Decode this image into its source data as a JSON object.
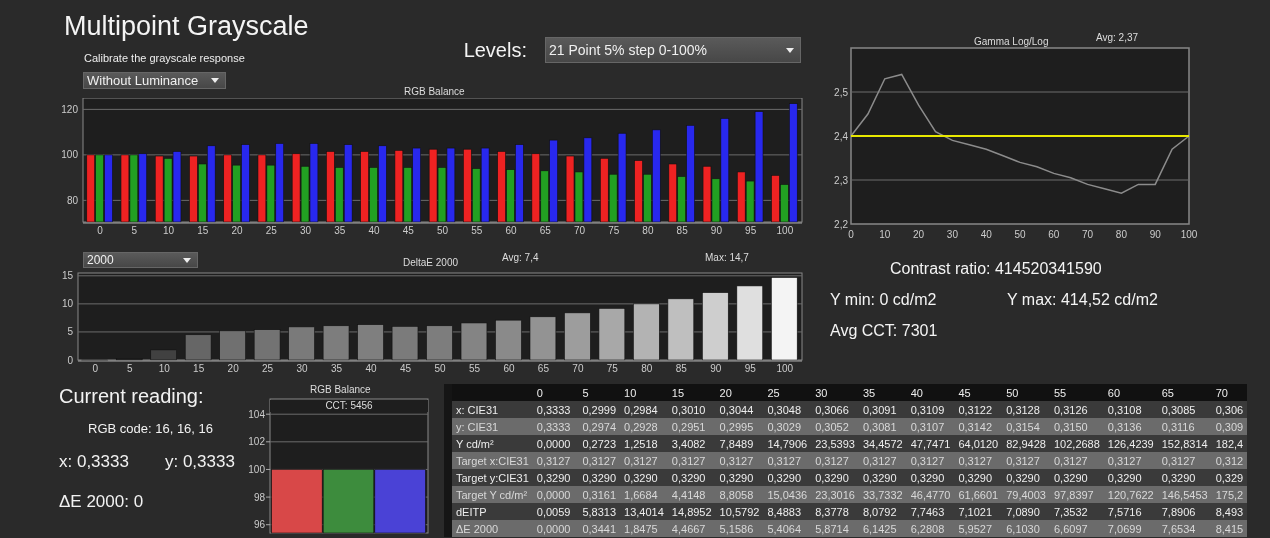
{
  "title": "Multipoint Grayscale",
  "calibrate_label": "Calibrate the grayscale response",
  "mode_dropdown": {
    "value": "Without Luminance"
  },
  "levels": {
    "label": "Levels:",
    "value": "21 Point 5% step 0-100%"
  },
  "rgb_balance": {
    "chart_data": {
      "type": "bar",
      "title": "RGB Balance",
      "categories": [
        "0",
        "5",
        "10",
        "15",
        "20",
        "25",
        "30",
        "35",
        "40",
        "45",
        "50",
        "55",
        "60",
        "65",
        "70",
        "75",
        "80",
        "85",
        "90",
        "95",
        "100"
      ],
      "ylim": [
        70.5,
        125
      ],
      "yticks": [
        80,
        100,
        120
      ],
      "grid": true,
      "series": [
        {
          "color": "#ee2222",
          "values": [
            100,
            100,
            99.5,
            99.5,
            100,
            100,
            100.5,
            101.5,
            101.5,
            102,
            102.5,
            102.5,
            101.5,
            100.5,
            99.5,
            98.5,
            97.5,
            96,
            95,
            92.5,
            91
          ]
        },
        {
          "color": "#22a022",
          "values": [
            100,
            100,
            98.5,
            96,
            95.5,
            95.5,
            95,
            94.5,
            94.5,
            94.5,
            94.5,
            94,
            93.5,
            93,
            92.5,
            91.5,
            91.5,
            90.5,
            89.5,
            88.5,
            87
          ]
        },
        {
          "color": "#2828ee",
          "values": [
            100,
            100.5,
            101.5,
            104,
            104.5,
            105,
            105,
            104.5,
            104,
            103,
            103,
            103,
            104.5,
            106.5,
            107.5,
            109.5,
            111,
            113,
            116,
            119,
            122.5
          ]
        }
      ]
    }
  },
  "delta_e": {
    "dropdown": {
      "value": "2000"
    },
    "avg": "Avg: 7,4",
    "max": "Max: 14,7",
    "chart_data": {
      "type": "bar",
      "title": "DeltaE 2000",
      "categories": [
        "0",
        "5",
        "10",
        "15",
        "20",
        "25",
        "30",
        "35",
        "40",
        "45",
        "50",
        "55",
        "60",
        "65",
        "70",
        "75",
        "80",
        "85",
        "90",
        "95",
        "100"
      ],
      "ylim": [
        0,
        15.5
      ],
      "yticks": [
        0,
        5,
        10,
        15
      ],
      "grid": true,
      "series": [
        {
          "values": [
            0,
            0.3,
            1.8,
            4.5,
            5.2,
            5.4,
            5.9,
            6.1,
            6.3,
            6,
            6.1,
            6.6,
            7.1,
            7.7,
            8.4,
            9.2,
            10,
            10.9,
            12,
            13.2,
            14.7
          ]
        }
      ]
    }
  },
  "gamma": {
    "avg": "Avg: 2,37",
    "chart_data": {
      "type": "line",
      "title": "Gamma Log/Log",
      "x": [
        0,
        5,
        10,
        15,
        20,
        25,
        30,
        35,
        40,
        45,
        50,
        55,
        60,
        65,
        70,
        75,
        80,
        85,
        90,
        95,
        100
      ],
      "xlim": [
        0,
        100
      ],
      "ylim": [
        2.2,
        2.6
      ],
      "xticks": [
        0,
        10,
        20,
        30,
        40,
        50,
        60,
        70,
        80,
        90,
        100
      ],
      "yticks": [
        {
          "value": 2.2,
          "label": "2,2"
        },
        {
          "value": 2.3,
          "label": "2,3"
        },
        {
          "value": 2.4,
          "label": "2,4"
        },
        {
          "value": 2.5,
          "label": "2,5"
        }
      ],
      "grid": true,
      "series": [
        {
          "color": "#8c8c8c",
          "values": [
            2.4,
            2.45,
            2.53,
            2.54,
            2.47,
            2.41,
            2.39,
            2.38,
            2.37,
            2.355,
            2.34,
            2.33,
            2.315,
            2.305,
            2.29,
            2.28,
            2.27,
            2.29,
            2.29,
            2.37,
            2.4
          ]
        },
        {
          "color": "#e8e800",
          "values": [
            2.4,
            2.4,
            2.4,
            2.4,
            2.4,
            2.4,
            2.4,
            2.4,
            2.4,
            2.4,
            2.4,
            2.4,
            2.4,
            2.4,
            2.4,
            2.4,
            2.4,
            2.4,
            2.4,
            2.4,
            2.4
          ]
        }
      ]
    }
  },
  "contrast_ratio": "Contrast ratio: 414520341590",
  "y_min": "Y min: 0 cd/m2",
  "y_max": "Y max: 414,52 cd/m2",
  "avg_cct": "Avg CCT: 7301",
  "current_reading": {
    "heading": "Current reading:",
    "rgb_code": "RGB code: 16, 16, 16",
    "x": "x: 0,3333",
    "y": "y: 0,3333",
    "delta_e": "ΔE 2000: 0"
  },
  "mini_balance": {
    "cct": "CCT: 5456",
    "chart_data": {
      "type": "bar",
      "title": "RGB Balance",
      "ylim": [
        95.4,
        105.1
      ],
      "yticks": [
        96,
        98,
        100,
        102,
        104
      ],
      "grid": true,
      "series": [
        {
          "color": "#d84848",
          "values": [
            100
          ]
        },
        {
          "color": "#3d8c3d",
          "values": [
            100
          ]
        },
        {
          "color": "#4a42d6",
          "values": [
            100
          ]
        }
      ]
    }
  },
  "table": {
    "columns": [
      "0",
      "5",
      "10",
      "15",
      "20",
      "25",
      "30",
      "35",
      "40",
      "45",
      "50",
      "55",
      "60",
      "65",
      "70"
    ],
    "rows": [
      {
        "label": "x: CIE31",
        "values": [
          "0,3333",
          "0,2999",
          "0,2984",
          "0,3010",
          "0,3044",
          "0,3048",
          "0,3066",
          "0,3091",
          "0,3109",
          "0,3122",
          "0,3128",
          "0,3126",
          "0,3108",
          "0,3085",
          "0,306"
        ]
      },
      {
        "label": "y: CIE31",
        "values": [
          "0,3333",
          "0,2974",
          "0,2928",
          "0,2951",
          "0,2995",
          "0,3029",
          "0,3052",
          "0,3081",
          "0,3107",
          "0,3142",
          "0,3154",
          "0,3150",
          "0,3136",
          "0,3116",
          "0,309"
        ]
      },
      {
        "label": "Y cd/m²",
        "values": [
          "0,0000",
          "0,2723",
          "1,2518",
          "3,4082",
          "7,8489",
          "14,7906",
          "23,5393",
          "34,4572",
          "47,7471",
          "64,0120",
          "82,9428",
          "102,2688",
          "126,4239",
          "152,8314",
          "182,4"
        ]
      },
      {
        "label": "Target x:CIE31",
        "values": [
          "0,3127",
          "0,3127",
          "0,3127",
          "0,3127",
          "0,3127",
          "0,3127",
          "0,3127",
          "0,3127",
          "0,3127",
          "0,3127",
          "0,3127",
          "0,3127",
          "0,3127",
          "0,3127",
          "0,312"
        ]
      },
      {
        "label": "Target y:CIE31",
        "values": [
          "0,3290",
          "0,3290",
          "0,3290",
          "0,3290",
          "0,3290",
          "0,3290",
          "0,3290",
          "0,3290",
          "0,3290",
          "0,3290",
          "0,3290",
          "0,3290",
          "0,3290",
          "0,3290",
          "0,329"
        ]
      },
      {
        "label": "Target Y cd/m²",
        "values": [
          "0,0000",
          "0,3161",
          "1,6684",
          "4,4148",
          "8,8058",
          "15,0436",
          "23,3016",
          "33,7332",
          "46,4770",
          "61,6601",
          "79,4003",
          "97,8397",
          "120,7622",
          "146,5453",
          "175,2"
        ]
      },
      {
        "label": "dEITP",
        "values": [
          "0,0059",
          "5,8313",
          "13,4014",
          "14,8952",
          "10,5792",
          "8,4883",
          "8,3778",
          "8,0792",
          "7,7463",
          "7,1021",
          "7,0890",
          "7,3532",
          "7,5716",
          "7,8906",
          "8,493"
        ]
      },
      {
        "label": "ΔE 2000",
        "values": [
          "0,0000",
          "0,3441",
          "1,8475",
          "4,4667",
          "5,1586",
          "5,4064",
          "5,8714",
          "6,1425",
          "6,2808",
          "5,9527",
          "6,1030",
          "6,6097",
          "7,0699",
          "7,6534",
          "8,415"
        ]
      }
    ]
  }
}
